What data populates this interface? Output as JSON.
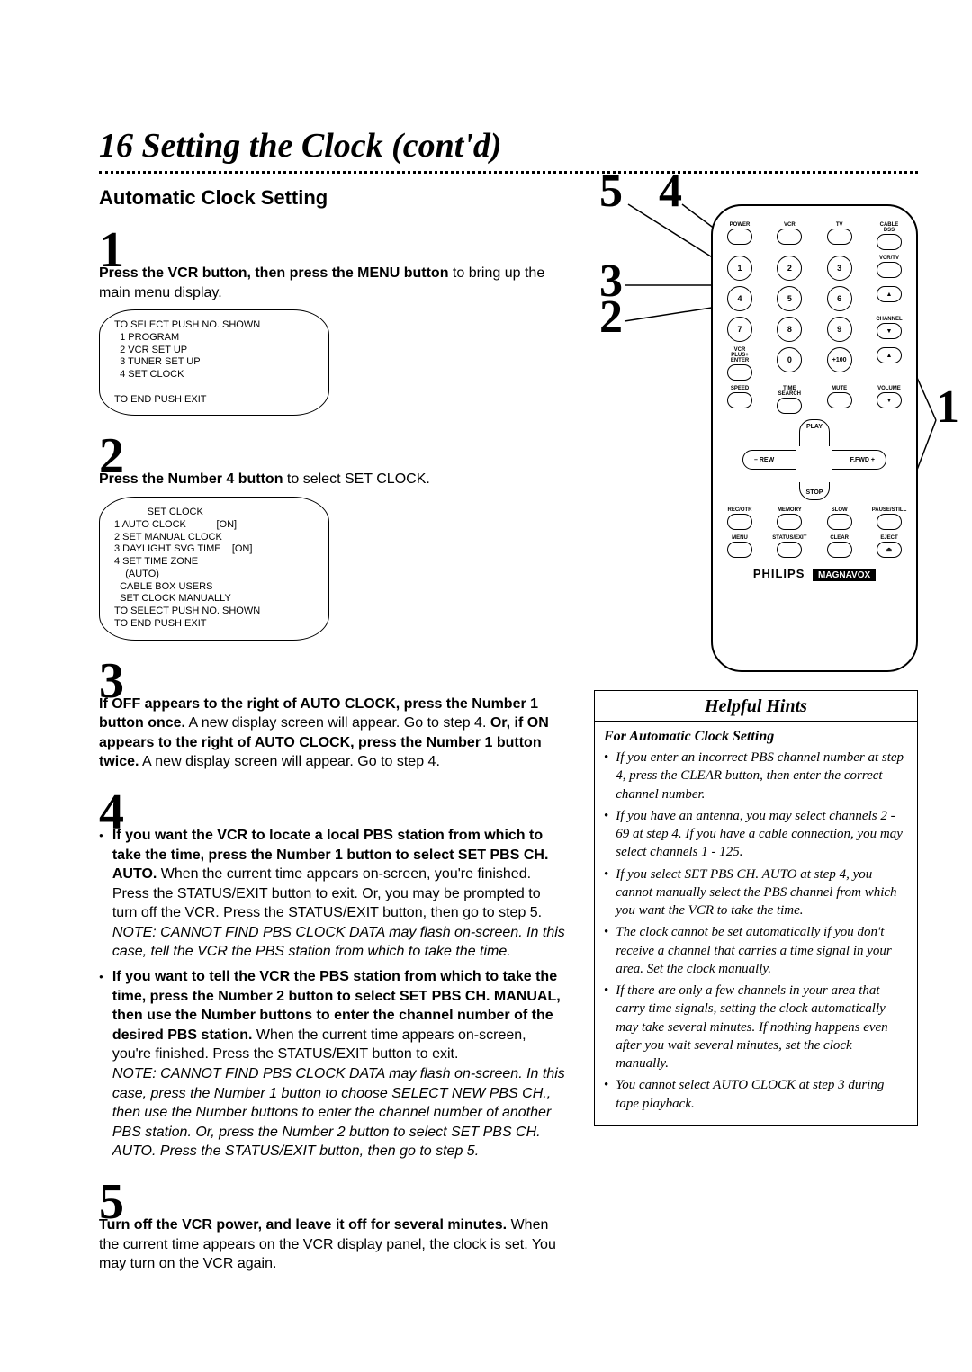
{
  "page": {
    "number": "16",
    "title": "Setting the Clock (cont'd)",
    "section": "Automatic Clock Setting"
  },
  "steps": {
    "s1": {
      "num": "1",
      "text_b1": "Press the VCR button, then press the MENU button",
      "text_p1": " to bring up the main menu display."
    },
    "osd1": "TO SELECT PUSH NO. SHOWN\n  1 PROGRAM\n  2 VCR SET UP\n  3 TUNER SET UP\n  4 SET CLOCK\n\nTO END PUSH EXIT",
    "s2": {
      "num": "2",
      "text_b1": "Press the Number 4 button",
      "text_p1": " to select SET CLOCK."
    },
    "osd2": "            SET CLOCK\n1 AUTO CLOCK           [ON]\n2 SET MANUAL CLOCK\n3 DAYLIGHT SVG TIME    [ON]\n4 SET TIME ZONE\n    (AUTO)\n  CABLE BOX USERS\n  SET CLOCK MANUALLY\nTO SELECT PUSH NO. SHOWN\nTO END PUSH EXIT",
    "s3": {
      "num": "3",
      "text_b1": "If OFF appears to the right of AUTO CLOCK, press the Number 1 button once.",
      "text_p1": " A new display screen will appear. Go to step 4. ",
      "text_b2": "Or, if ON appears to the right of AUTO CLOCK, press the Number 1 button twice.",
      "text_p2": " A new display screen will appear. Go to step 4."
    },
    "s4": {
      "num": "4",
      "a_b1": "If you want the VCR to locate a local PBS station from which to take the time, press the Number 1 button to select SET PBS CH. AUTO.",
      "a_p1": " When the current time appears on-screen, you're finished. Press the STATUS/EXIT button to exit. Or, you may be prompted to turn off the VCR. Press the STATUS/EXIT button, then go to step 5.",
      "a_note": "NOTE: CANNOT FIND PBS CLOCK DATA may flash on-screen. In this case, tell the VCR the PBS station from which to take the time.",
      "b_b1": "If you want to tell the VCR the PBS station from which to take the time, press the Number 2 button to select SET PBS CH. MANUAL, then use the Number buttons to enter the channel number of the desired PBS station.",
      "b_p1": " When the current time appears on-screen, you're finished. Press the STATUS/EXIT button to exit.",
      "b_note": "NOTE: CANNOT FIND PBS CLOCK DATA may flash on-screen. In this case, press the Number 1 button to choose SELECT NEW PBS CH., then use the Number buttons to enter the channel number of another PBS station. Or, press the Number 2 button to select SET PBS CH. AUTO. Press the STATUS/EXIT button, then go to step 5."
    },
    "s5": {
      "num": "5",
      "text_b1": "Turn off the VCR power, and leave it off for several minutes.",
      "text_p1": " When the current time appears on the VCR display panel, the clock is set. You may turn on the VCR again."
    }
  },
  "callouts": {
    "c1": "1",
    "c2": "2",
    "c3": "3",
    "c4": "4",
    "c5": "5"
  },
  "remote": {
    "top_left": "POWER",
    "top_vcr": "VCR",
    "top_tv": "TV",
    "top_cable": "CABLE DSS",
    "vcr_tv": "VCR/TV",
    "nums": [
      "1",
      "2",
      "3",
      "4",
      "5",
      "6",
      "7",
      "8",
      "9",
      "0",
      "+100"
    ],
    "channel": "CHANNEL",
    "vcrplus": "VCR PLUS+ ENTER",
    "row_labels": [
      "SPEED",
      "TIME SEARCH",
      "MUTE",
      "VOLUME"
    ],
    "cross": {
      "play": "PLAY",
      "stop": "STOP",
      "rew": "REW",
      "ffwd": "F.FWD",
      "minus": "–",
      "plus": "+",
      "up": "▲",
      "down": "▼"
    },
    "bottom_row1": [
      "REC/OTR",
      "MEMORY",
      "SLOW",
      "PAUSE/STILL"
    ],
    "bottom_row2": [
      "MENU",
      "STATUS/EXIT",
      "CLEAR",
      "EJECT"
    ],
    "brand": "PHILIPS",
    "brand2": "MAGNAVOX"
  },
  "hints": {
    "title": "Helpful Hints",
    "sub": "For Automatic Clock Setting",
    "items": [
      "If you enter an incorrect PBS channel number at step 4, press the CLEAR button, then enter the correct channel number.",
      "If you have an antenna, you may select channels 2 - 69 at step 4. If you have a cable connection, you may select channels 1 - 125.",
      "If you select SET PBS CH. AUTO at step 4, you cannot manually select the PBS channel from which you want the VCR to take the time.",
      "The clock cannot be set automatically if you don't receive a channel that carries a time signal in your area. Set the clock manually.",
      "If there are only a few channels in your area that carry time signals, setting the clock automatically may take several minutes. If nothing happens even after you wait several minutes, set the clock manually.",
      "You cannot select AUTO CLOCK at step 3 during tape playback."
    ]
  }
}
